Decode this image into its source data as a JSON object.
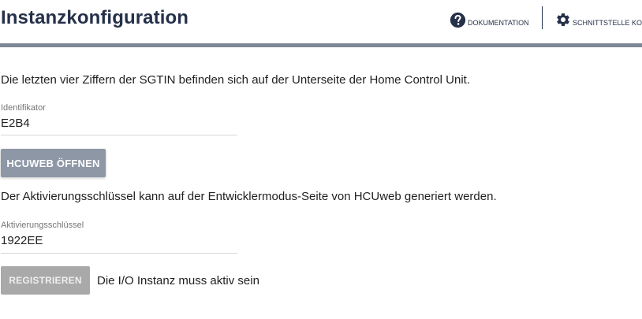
{
  "header": {
    "title": "Instanzkonfiguration",
    "docs_label": "DOKUMENTATION",
    "interface_label": "SCHNITTSTELLE KO",
    "docs_icon": "help-circle-icon",
    "interface_icon": "gear-icon",
    "accent_color": "#253049",
    "bar_color": "#7d8796"
  },
  "main": {
    "sgtin_info": "Die letzten vier Ziffern der SGTIN befinden sich auf der Unterseite der Home Control Unit.",
    "identifier": {
      "label": "Identifikator",
      "value": "E2B4"
    },
    "open_button_label": "HCUWEB ÖFFNEN",
    "activation_info": "Der Aktivierungsschlüssel kann auf der Entwicklermodus-Seite von HCUweb generiert werden.",
    "activation_key": {
      "label": "Aktivierungsschlüssel",
      "value": "1922EE"
    },
    "register_button_label": "REGISTRIEREN",
    "register_hint": "Die I/O Instanz muss aktiv sein"
  }
}
